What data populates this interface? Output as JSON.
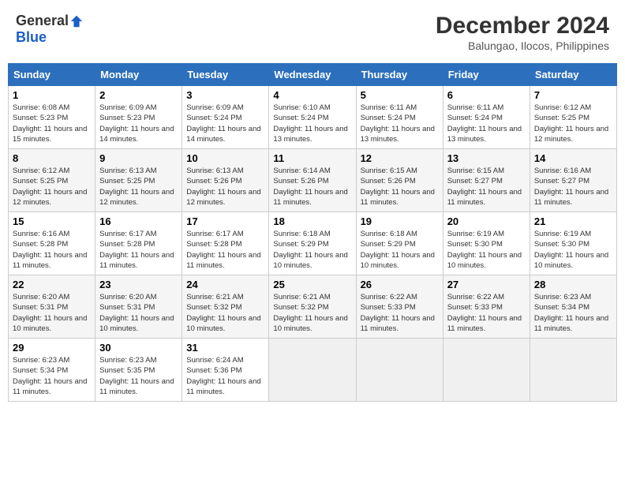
{
  "logo": {
    "general": "General",
    "blue": "Blue"
  },
  "title": {
    "month": "December 2024",
    "location": "Balungao, Ilocos, Philippines"
  },
  "headers": [
    "Sunday",
    "Monday",
    "Tuesday",
    "Wednesday",
    "Thursday",
    "Friday",
    "Saturday"
  ],
  "weeks": [
    [
      {
        "day": "1",
        "sunrise": "6:08 AM",
        "sunset": "5:23 PM",
        "daylight": "11 hours and 15 minutes."
      },
      {
        "day": "2",
        "sunrise": "6:09 AM",
        "sunset": "5:23 PM",
        "daylight": "11 hours and 14 minutes."
      },
      {
        "day": "3",
        "sunrise": "6:09 AM",
        "sunset": "5:24 PM",
        "daylight": "11 hours and 14 minutes."
      },
      {
        "day": "4",
        "sunrise": "6:10 AM",
        "sunset": "5:24 PM",
        "daylight": "11 hours and 13 minutes."
      },
      {
        "day": "5",
        "sunrise": "6:11 AM",
        "sunset": "5:24 PM",
        "daylight": "11 hours and 13 minutes."
      },
      {
        "day": "6",
        "sunrise": "6:11 AM",
        "sunset": "5:24 PM",
        "daylight": "11 hours and 13 minutes."
      },
      {
        "day": "7",
        "sunrise": "6:12 AM",
        "sunset": "5:25 PM",
        "daylight": "11 hours and 12 minutes."
      }
    ],
    [
      {
        "day": "8",
        "sunrise": "6:12 AM",
        "sunset": "5:25 PM",
        "daylight": "11 hours and 12 minutes."
      },
      {
        "day": "9",
        "sunrise": "6:13 AM",
        "sunset": "5:25 PM",
        "daylight": "11 hours and 12 minutes."
      },
      {
        "day": "10",
        "sunrise": "6:13 AM",
        "sunset": "5:26 PM",
        "daylight": "11 hours and 12 minutes."
      },
      {
        "day": "11",
        "sunrise": "6:14 AM",
        "sunset": "5:26 PM",
        "daylight": "11 hours and 11 minutes."
      },
      {
        "day": "12",
        "sunrise": "6:15 AM",
        "sunset": "5:26 PM",
        "daylight": "11 hours and 11 minutes."
      },
      {
        "day": "13",
        "sunrise": "6:15 AM",
        "sunset": "5:27 PM",
        "daylight": "11 hours and 11 minutes."
      },
      {
        "day": "14",
        "sunrise": "6:16 AM",
        "sunset": "5:27 PM",
        "daylight": "11 hours and 11 minutes."
      }
    ],
    [
      {
        "day": "15",
        "sunrise": "6:16 AM",
        "sunset": "5:28 PM",
        "daylight": "11 hours and 11 minutes."
      },
      {
        "day": "16",
        "sunrise": "6:17 AM",
        "sunset": "5:28 PM",
        "daylight": "11 hours and 11 minutes."
      },
      {
        "day": "17",
        "sunrise": "6:17 AM",
        "sunset": "5:28 PM",
        "daylight": "11 hours and 11 minutes."
      },
      {
        "day": "18",
        "sunrise": "6:18 AM",
        "sunset": "5:29 PM",
        "daylight": "11 hours and 10 minutes."
      },
      {
        "day": "19",
        "sunrise": "6:18 AM",
        "sunset": "5:29 PM",
        "daylight": "11 hours and 10 minutes."
      },
      {
        "day": "20",
        "sunrise": "6:19 AM",
        "sunset": "5:30 PM",
        "daylight": "11 hours and 10 minutes."
      },
      {
        "day": "21",
        "sunrise": "6:19 AM",
        "sunset": "5:30 PM",
        "daylight": "11 hours and 10 minutes."
      }
    ],
    [
      {
        "day": "22",
        "sunrise": "6:20 AM",
        "sunset": "5:31 PM",
        "daylight": "11 hours and 10 minutes."
      },
      {
        "day": "23",
        "sunrise": "6:20 AM",
        "sunset": "5:31 PM",
        "daylight": "11 hours and 10 minutes."
      },
      {
        "day": "24",
        "sunrise": "6:21 AM",
        "sunset": "5:32 PM",
        "daylight": "11 hours and 10 minutes."
      },
      {
        "day": "25",
        "sunrise": "6:21 AM",
        "sunset": "5:32 PM",
        "daylight": "11 hours and 10 minutes."
      },
      {
        "day": "26",
        "sunrise": "6:22 AM",
        "sunset": "5:33 PM",
        "daylight": "11 hours and 11 minutes."
      },
      {
        "day": "27",
        "sunrise": "6:22 AM",
        "sunset": "5:33 PM",
        "daylight": "11 hours and 11 minutes."
      },
      {
        "day": "28",
        "sunrise": "6:23 AM",
        "sunset": "5:34 PM",
        "daylight": "11 hours and 11 minutes."
      }
    ],
    [
      {
        "day": "29",
        "sunrise": "6:23 AM",
        "sunset": "5:34 PM",
        "daylight": "11 hours and 11 minutes."
      },
      {
        "day": "30",
        "sunrise": "6:23 AM",
        "sunset": "5:35 PM",
        "daylight": "11 hours and 11 minutes."
      },
      {
        "day": "31",
        "sunrise": "6:24 AM",
        "sunset": "5:36 PM",
        "daylight": "11 hours and 11 minutes."
      },
      null,
      null,
      null,
      null
    ]
  ]
}
